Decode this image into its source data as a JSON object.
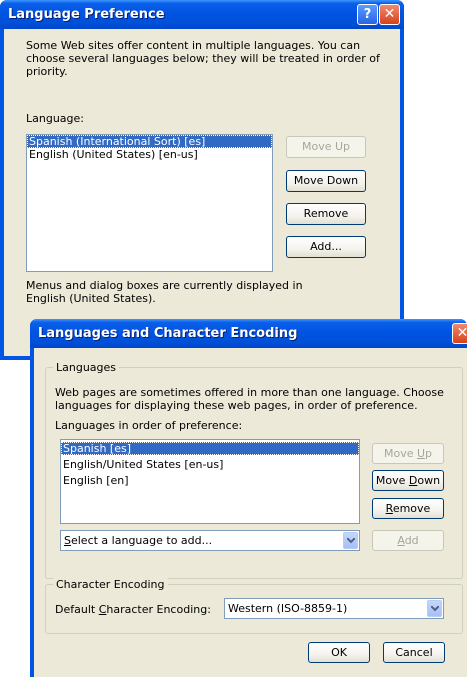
{
  "lang_pref_dialog": {
    "title": "Language Preference",
    "help_glyph": "?",
    "close_glyph": "✕",
    "description": "Some Web sites offer content in multiple languages. You can choose several languages below; they will be treated in order of priority.",
    "language_label": "Language:",
    "languages": [
      "Spanish (International Sort) [es]",
      "English (United States) [en-us]"
    ],
    "move_up": "Move Up",
    "move_down": "Move Down",
    "remove": "Remove",
    "add": "Add...",
    "status_text": "Menus and dialog boxes are currently displayed in English (United States)."
  },
  "lang_enc_dialog": {
    "title": "Languages and Character Encoding",
    "close_glyph": "✕",
    "languages_group": "Languages",
    "description": "Web pages are sometimes offered in more than one language. Choose languages for displaying these web pages, in order of preference.",
    "order_label": "Languages in order of preference:",
    "languages": [
      "Spanish  [es]",
      "English/United States  [en-us]",
      "English  [en]"
    ],
    "move_up": {
      "pre": "Move ",
      "key": "U",
      "post": "p"
    },
    "move_down": {
      "pre": "Move ",
      "key": "D",
      "post": "own"
    },
    "remove": {
      "pre": "",
      "key": "R",
      "post": "emove"
    },
    "add": {
      "pre": "",
      "key": "A",
      "post": "dd"
    },
    "add_select": {
      "pre": "",
      "key": "S",
      "post": "elect a language to add..."
    },
    "char_group": "Character Encoding",
    "char_label": {
      "pre": "Default ",
      "key": "C",
      "post": "haracter Encoding:"
    },
    "char_value": "Western (ISO-8859-1)",
    "ok": "OK",
    "cancel": "Cancel"
  },
  "colors": {
    "titlebar": "#0054e3",
    "dialog_face": "#ece9d8",
    "selection": "#316ac5",
    "close_button": "#d9401b"
  }
}
